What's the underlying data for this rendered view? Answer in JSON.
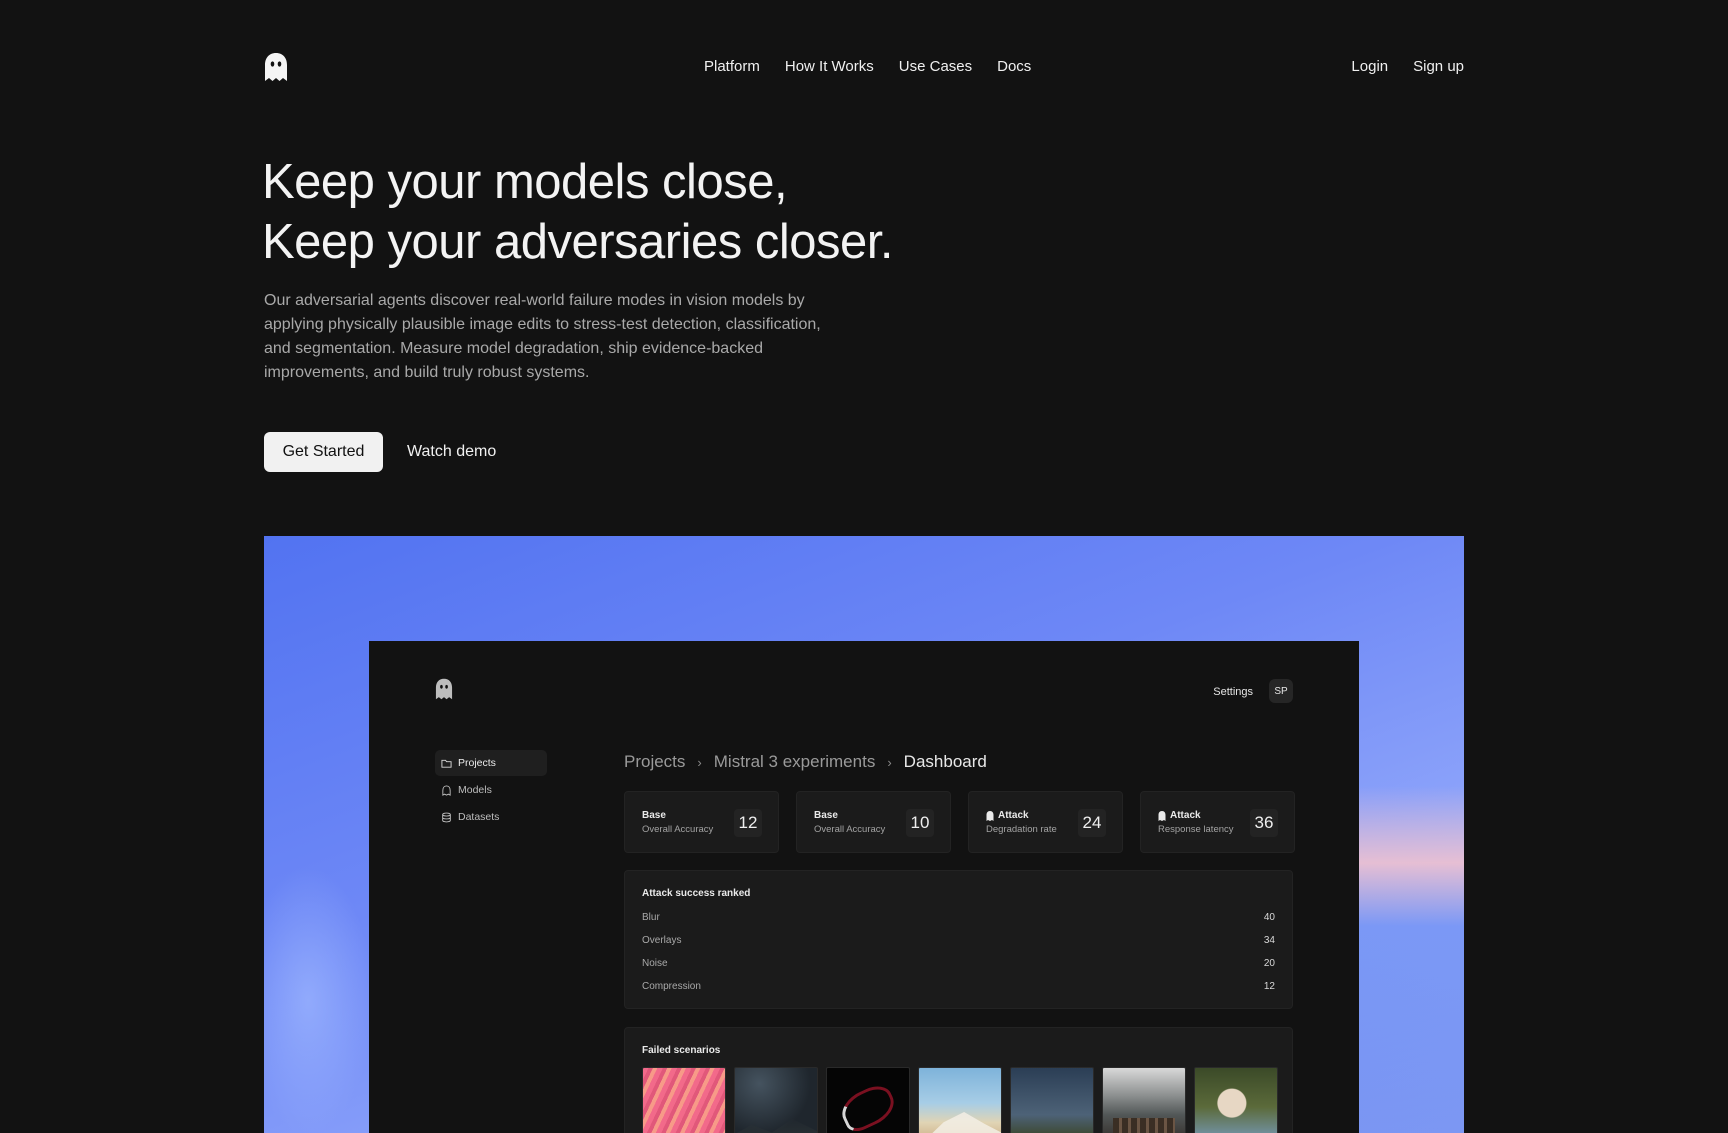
{
  "nav": {
    "links": [
      "Platform",
      "How It Works",
      "Use Cases",
      "Docs"
    ],
    "login": "Login",
    "signup": "Sign up"
  },
  "hero": {
    "title_line1": "Keep your models close,",
    "title_line2": "Keep your adversaries closer.",
    "subtitle": "Our adversarial agents discover real-world failure modes in vision models by applying physically plausible image edits to stress-test detection, classification, and segmentation. Measure model degradation, ship evidence-backed improvements, and build truly robust systems.",
    "cta_primary": "Get Started",
    "cta_secondary": "Watch demo"
  },
  "app": {
    "settings": "Settings",
    "avatar": "SP",
    "sidebar": [
      {
        "label": "Projects",
        "icon": "folder-icon",
        "active": true
      },
      {
        "label": "Models",
        "icon": "model-icon",
        "active": false
      },
      {
        "label": "Datasets",
        "icon": "database-icon",
        "active": false
      }
    ],
    "breadcrumb": [
      "Projects",
      "Mistral 3 experiments",
      "Dashboard"
    ],
    "breadcrumb_sep": "›",
    "stats": [
      {
        "title": "Base",
        "desc": "Overall Accuracy",
        "value": "12",
        "locked": false
      },
      {
        "title": "Base",
        "desc": "Overall Accuracy",
        "value": "10",
        "locked": false
      },
      {
        "title": "Attack",
        "desc": "Degradation rate",
        "value": "24",
        "locked": true
      },
      {
        "title": "Attack",
        "desc": "Response latency",
        "value": "36",
        "locked": true
      }
    ],
    "ranked": {
      "title": "Attack success ranked",
      "rows": [
        {
          "label": "Blur",
          "value": "40"
        },
        {
          "label": "Overlays",
          "value": "34"
        },
        {
          "label": "Noise",
          "value": "20"
        },
        {
          "label": "Compression",
          "value": "12"
        }
      ]
    },
    "failed": {
      "title": "Failed scenarios"
    }
  },
  "colors": {
    "background": "#121212",
    "accent_blue": "#5273f1"
  }
}
